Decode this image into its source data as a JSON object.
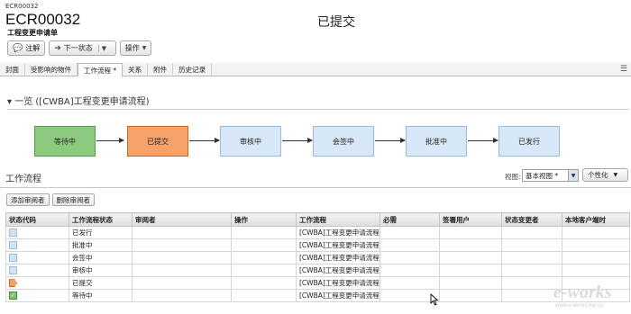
{
  "header": {
    "small_id": "ECR00032",
    "big_id": "ECR00032",
    "subtitle": "工程变更申请单",
    "status": "已提交"
  },
  "toolbar": {
    "note_label": "注解",
    "next_state_label": "下一状态",
    "actions_label": "操作"
  },
  "tabs": [
    "封面",
    "受影响的物件",
    "工作流程 *",
    "关系",
    "附件",
    "历史记录"
  ],
  "overview": {
    "title": "一览 ([CWBA]工程变更申请流程)"
  },
  "flow": {
    "steps": [
      {
        "label": "等待中",
        "fill": "#8ccb7e",
        "border": "#5a9a4e"
      },
      {
        "label": "已提交",
        "fill": "#f7a16b",
        "border": "#c56b2a"
      },
      {
        "label": "审核中",
        "fill": "#d8e8f8",
        "border": "#9cbbdb"
      },
      {
        "label": "会签中",
        "fill": "#d8e8f8",
        "border": "#9cbbdb"
      },
      {
        "label": "批准中",
        "fill": "#d8e8f8",
        "border": "#9cbbdb"
      },
      {
        "label": "已发行",
        "fill": "#d8e8f8",
        "border": "#9cbbdb"
      }
    ]
  },
  "workflow": {
    "title": "工作流程",
    "view_label": "视图:",
    "view_value": "基本视图 *",
    "personalize_label": "个性化",
    "add_reviewer": "添加审阅者",
    "remove_reviewer": "删除审阅者",
    "columns": [
      "状态代码",
      "工作流程状态",
      "审阅者",
      "操作",
      "工作流程",
      "必需",
      "签署用户",
      "状态变更者",
      "本地客户端时"
    ],
    "rows": [
      {
        "icon": "status-pending-icon",
        "state": "已发行",
        "workflow": "[CWBA]工程变更申请流程"
      },
      {
        "icon": "status-pending-icon",
        "state": "批准中",
        "workflow": "[CWBA]工程变更申请流程"
      },
      {
        "icon": "status-pending-icon",
        "state": "会签中",
        "workflow": "[CWBA]工程变更申请流程"
      },
      {
        "icon": "status-pending-icon",
        "state": "审核中",
        "workflow": "[CWBA]工程变更申请流程"
      },
      {
        "icon": "status-current-icon",
        "state": "已提交",
        "workflow": "[CWBA]工程变更申请流程"
      },
      {
        "icon": "status-complete-icon",
        "state": "等待中",
        "workflow": "[CWBA]工程变更申请流程"
      }
    ]
  },
  "watermark": {
    "text": "e-works",
    "url_text": "www.e-works.net.cn"
  }
}
